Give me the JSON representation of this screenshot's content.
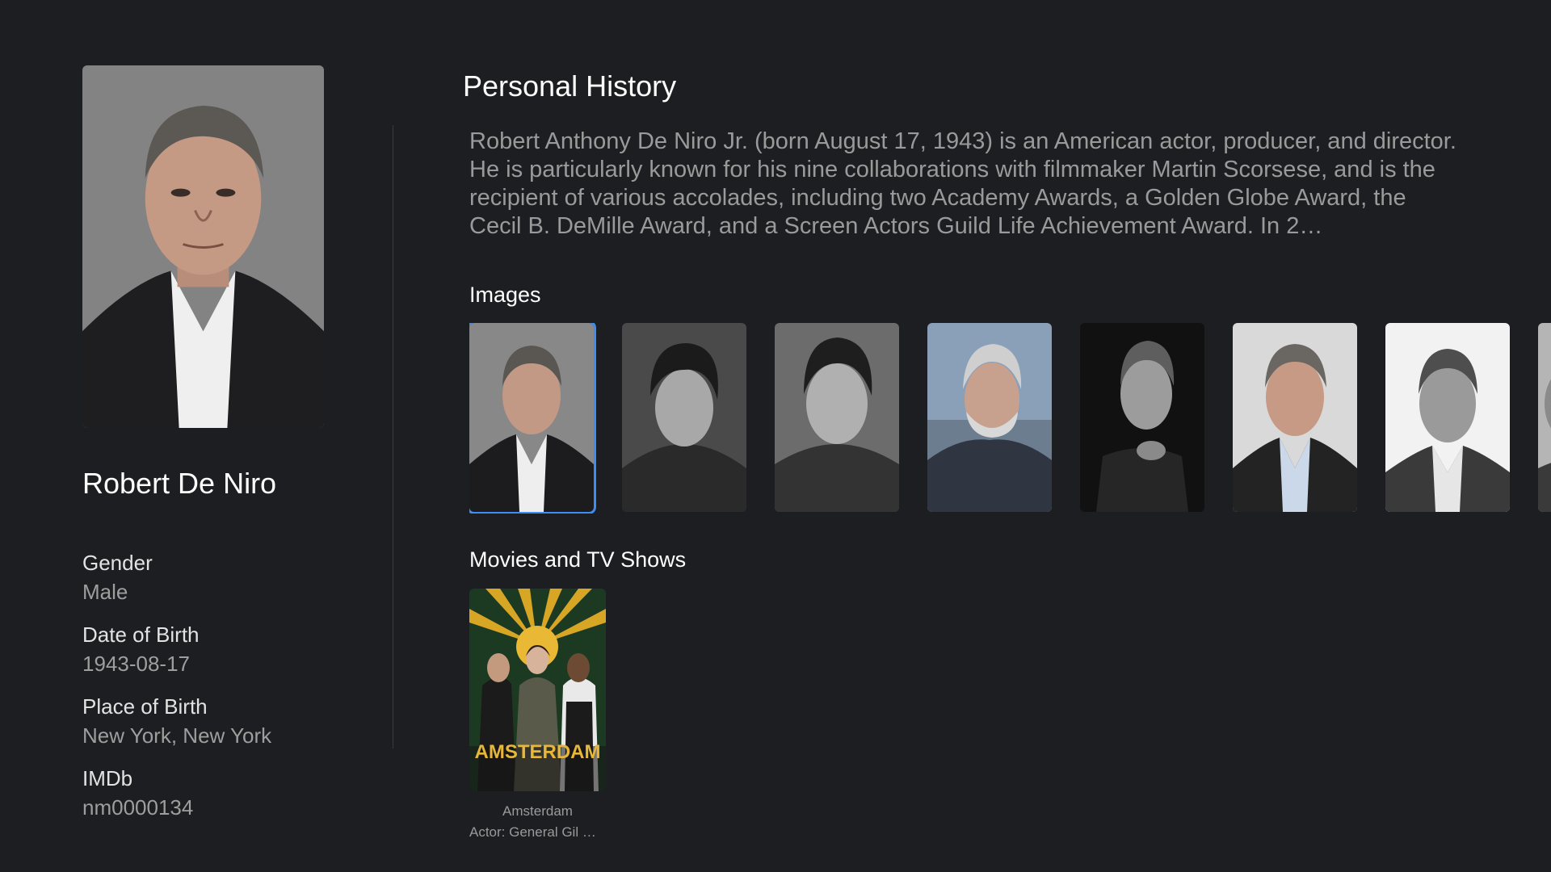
{
  "person": {
    "name": "Robert De Niro",
    "facts": [
      {
        "label": "Gender",
        "value": "Male"
      },
      {
        "label": "Date of Birth",
        "value": "1943-08-17"
      },
      {
        "label": "Place of Birth",
        "value": "New York, New York"
      },
      {
        "label": "IMDb",
        "value": "nm0000134"
      }
    ]
  },
  "history": {
    "title": "Personal History",
    "text": "Robert Anthony De Niro Jr. (born August 17, 1943) is an American actor, producer, and director. He is particularly known for his nine collaborations with filmmaker Martin Scorsese, and is the recipient of various accolades, including two Academy Awards, a Golden Globe Award, the Cecil B. DeMille Award, and a Screen Actors Guild Life Achievement Award. In 2…"
  },
  "images": {
    "title": "Images",
    "selected_index": 0
  },
  "movies": {
    "title": "Movies and TV Shows",
    "items": [
      {
        "title": "Amsterdam",
        "poster_text": "AMSTERDAM",
        "role": "Actor: General Gil D…"
      }
    ]
  },
  "colors": {
    "background": "#1d1e21",
    "focus_ring": "#3d8df5",
    "secondary_text": "#9a9a9a"
  }
}
